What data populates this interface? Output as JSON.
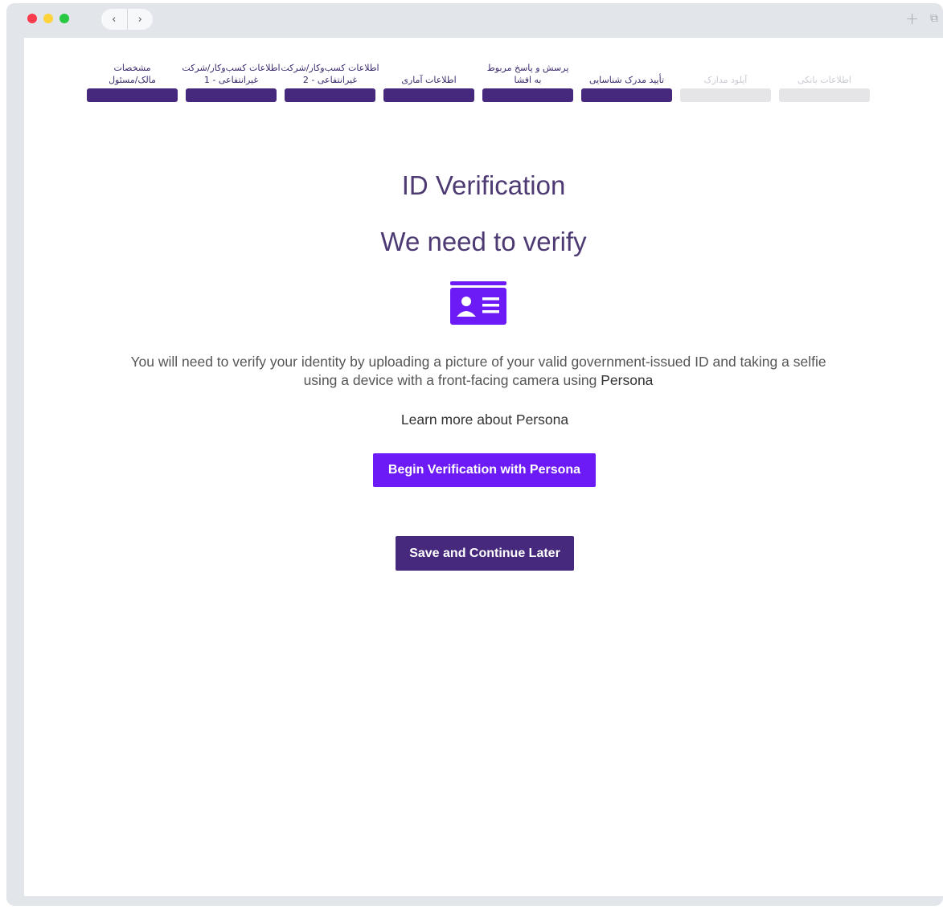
{
  "browser": {
    "back": "‹",
    "forward": "›",
    "new_tab": "+",
    "tabs_icon": "⧉"
  },
  "steps": [
    {
      "label": "مشخصات\nمالک/مسئول",
      "status": "complete"
    },
    {
      "label": "اطلاعات کسب‌وکار/شرکت\nغیرانتفاعی - 1",
      "status": "complete"
    },
    {
      "label": "اطلاعات کسب‌وکار/شرکت\nغیرانتفاعی - 2",
      "status": "complete"
    },
    {
      "label": "اطلاعات آماری",
      "status": "complete"
    },
    {
      "label": "پرسش و پاسخ مربوط\nبه افشا",
      "status": "complete"
    },
    {
      "label": "تأیید مدرک شناسایی",
      "status": "current"
    },
    {
      "label": "آپلود مدارک",
      "status": "upcoming"
    },
    {
      "label": "اطلاعات بانکی",
      "status": "upcoming"
    }
  ],
  "main": {
    "title": "ID Verification",
    "subtitle": "We need to verify",
    "icon": "id-card-icon",
    "description": "You will need to verify your identity by uploading a picture of your valid government-issued ID and taking a selfie using a device with a front-facing camera using",
    "brand": "Persona",
    "learn_more": "Learn more about Persona",
    "begin_button": "Begin Verification with Persona",
    "save_button": "Save and Continue Later"
  },
  "colors": {
    "step_active": "#46287d",
    "step_inactive": "#e5e5e8",
    "primary_button": "#6d1bf6",
    "secondary_button": "#46287d",
    "icon": "#6d1bf6"
  }
}
